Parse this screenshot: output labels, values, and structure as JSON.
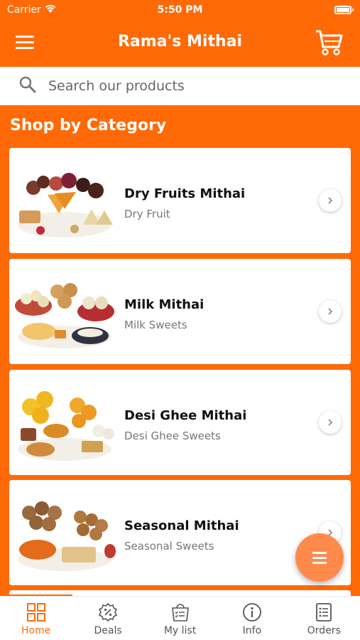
{
  "status_bar": {
    "carrier": "Carrier",
    "time": "5:50 PM"
  },
  "header": {
    "title": "Rama's Mithai"
  },
  "search": {
    "placeholder": "Search our products"
  },
  "section": {
    "title": "Shop by Category"
  },
  "categories": [
    {
      "name": "Dry Fruits Mithai",
      "subtitle": "Dry Fruit"
    },
    {
      "name": "Milk Mithai",
      "subtitle": "Milk Sweets"
    },
    {
      "name": "Desi Ghee Mithai",
      "subtitle": "Desi Ghee Sweets"
    },
    {
      "name": "Seasonal Mithai",
      "subtitle": "Seasonal Sweets"
    }
  ],
  "tabs": [
    {
      "label": "Home",
      "icon": "grid-icon",
      "active": true
    },
    {
      "label": "Deals",
      "icon": "badge-percent-icon"
    },
    {
      "label": "My list",
      "icon": "shopping-list-icon"
    },
    {
      "label": "Info",
      "icon": "info-icon"
    },
    {
      "label": "Orders",
      "icon": "orders-list-icon"
    }
  ],
  "colors": {
    "accent": "#ff6a06",
    "fab": "#ff8a4c"
  }
}
